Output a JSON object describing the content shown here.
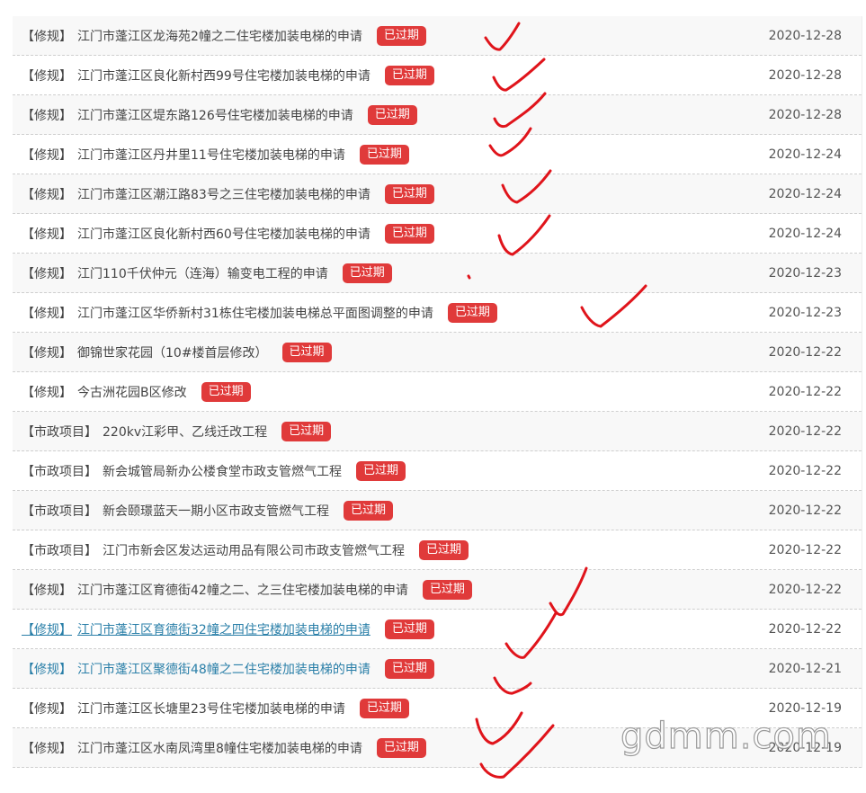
{
  "badge_label": "已过期",
  "rows": [
    {
      "tag": "【修规】",
      "title": "江门市蓬江区龙海苑2幢之二住宅楼加装电梯的申请",
      "date": "2020-12-28",
      "state": ""
    },
    {
      "tag": "【修规】",
      "title": "江门市蓬江区良化新村西99号住宅楼加装电梯的申请",
      "date": "2020-12-28",
      "state": ""
    },
    {
      "tag": "【修规】",
      "title": "江门市蓬江区堤东路126号住宅楼加装电梯的申请",
      "date": "2020-12-28",
      "state": ""
    },
    {
      "tag": "【修规】",
      "title": "江门市蓬江区丹井里11号住宅楼加装电梯的申请",
      "date": "2020-12-24",
      "state": ""
    },
    {
      "tag": "【修规】",
      "title": "江门市蓬江区潮江路83号之三住宅楼加装电梯的申请",
      "date": "2020-12-24",
      "state": ""
    },
    {
      "tag": "【修规】",
      "title": "江门市蓬江区良化新村西60号住宅楼加装电梯的申请",
      "date": "2020-12-24",
      "state": ""
    },
    {
      "tag": "【修规】",
      "title": "江门110千伏仲元（连海）输变电工程的申请",
      "date": "2020-12-23",
      "state": ""
    },
    {
      "tag": "【修规】",
      "title": "江门市蓬江区华侨新村31栋住宅楼加装电梯总平面图调整的申请",
      "date": "2020-12-23",
      "state": ""
    },
    {
      "tag": "【修规】",
      "title": "御锦世家花园（10#楼首层修改）",
      "date": "2020-12-22",
      "state": ""
    },
    {
      "tag": "【修规】",
      "title": "今古洲花园B区修改",
      "date": "2020-12-22",
      "state": ""
    },
    {
      "tag": "【市政项目】",
      "title": "220kv江彩甲、乙线迁改工程",
      "date": "2020-12-22",
      "state": ""
    },
    {
      "tag": "【市政项目】",
      "title": "新会城管局新办公楼食堂市政支管燃气工程",
      "date": "2020-12-22",
      "state": ""
    },
    {
      "tag": "【市政项目】",
      "title": "新会颐璟蓝天一期小区市政支管燃气工程",
      "date": "2020-12-22",
      "state": ""
    },
    {
      "tag": "【市政项目】",
      "title": "江门市新会区发达运动用品有限公司市政支管燃气工程",
      "date": "2020-12-22",
      "state": ""
    },
    {
      "tag": "【修规】",
      "title": "江门市蓬江区育德街42幢之二、之三住宅楼加装电梯的申请",
      "date": "2020-12-22",
      "state": ""
    },
    {
      "tag": "【修规】",
      "title": "江门市蓬江区育德街32幢之四住宅楼加装电梯的申请",
      "date": "2020-12-22",
      "state": "hover"
    },
    {
      "tag": "【修规】",
      "title": "江门市蓬江区聚德街48幢之二住宅楼加装电梯的申请",
      "date": "2020-12-21",
      "state": "visited"
    },
    {
      "tag": "【修规】",
      "title": "江门市蓬江区长塘里23号住宅楼加装电梯的申请",
      "date": "2020-12-19",
      "state": ""
    },
    {
      "tag": "【修规】",
      "title": "江门市蓬江区水南凤湾里8幢住宅楼加装电梯的申请",
      "date": "2020-12-19",
      "state": ""
    }
  ],
  "annotation_color": "#e0141b",
  "watermark": "gdmm.com"
}
